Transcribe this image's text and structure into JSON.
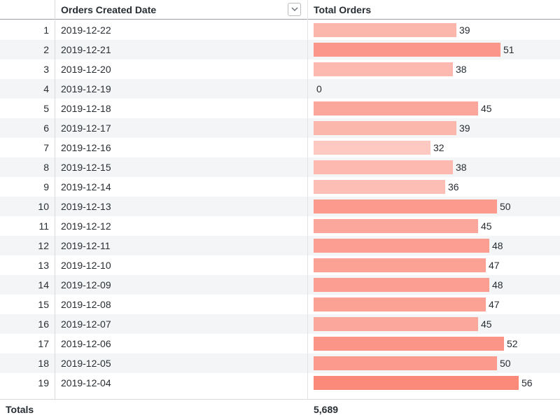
{
  "table": {
    "columns": {
      "date_header": "Orders Created Date",
      "orders_header": "Total Orders"
    },
    "rows": [
      {
        "index": "1",
        "date": "2019-12-22",
        "orders": 39
      },
      {
        "index": "2",
        "date": "2019-12-21",
        "orders": 51
      },
      {
        "index": "3",
        "date": "2019-12-20",
        "orders": 38
      },
      {
        "index": "4",
        "date": "2019-12-19",
        "orders": 0
      },
      {
        "index": "5",
        "date": "2019-12-18",
        "orders": 45
      },
      {
        "index": "6",
        "date": "2019-12-17",
        "orders": 39
      },
      {
        "index": "7",
        "date": "2019-12-16",
        "orders": 32
      },
      {
        "index": "8",
        "date": "2019-12-15",
        "orders": 38
      },
      {
        "index": "9",
        "date": "2019-12-14",
        "orders": 36
      },
      {
        "index": "10",
        "date": "2019-12-13",
        "orders": 50
      },
      {
        "index": "11",
        "date": "2019-12-12",
        "orders": 45
      },
      {
        "index": "12",
        "date": "2019-12-11",
        "orders": 48
      },
      {
        "index": "13",
        "date": "2019-12-10",
        "orders": 47
      },
      {
        "index": "14",
        "date": "2019-12-09",
        "orders": 48
      },
      {
        "index": "15",
        "date": "2019-12-08",
        "orders": 47
      },
      {
        "index": "16",
        "date": "2019-12-07",
        "orders": 45
      },
      {
        "index": "17",
        "date": "2019-12-06",
        "orders": 52
      },
      {
        "index": "18",
        "date": "2019-12-05",
        "orders": 50
      },
      {
        "index": "19",
        "date": "2019-12-04",
        "orders": 56
      }
    ],
    "totals_label": "Totals",
    "totals_value": "5,689"
  },
  "icons": {
    "sort": "chevron-down-icon"
  },
  "colors": {
    "bar_light": "#fdc9c1",
    "bar_dark": "#fb8a7b"
  }
}
